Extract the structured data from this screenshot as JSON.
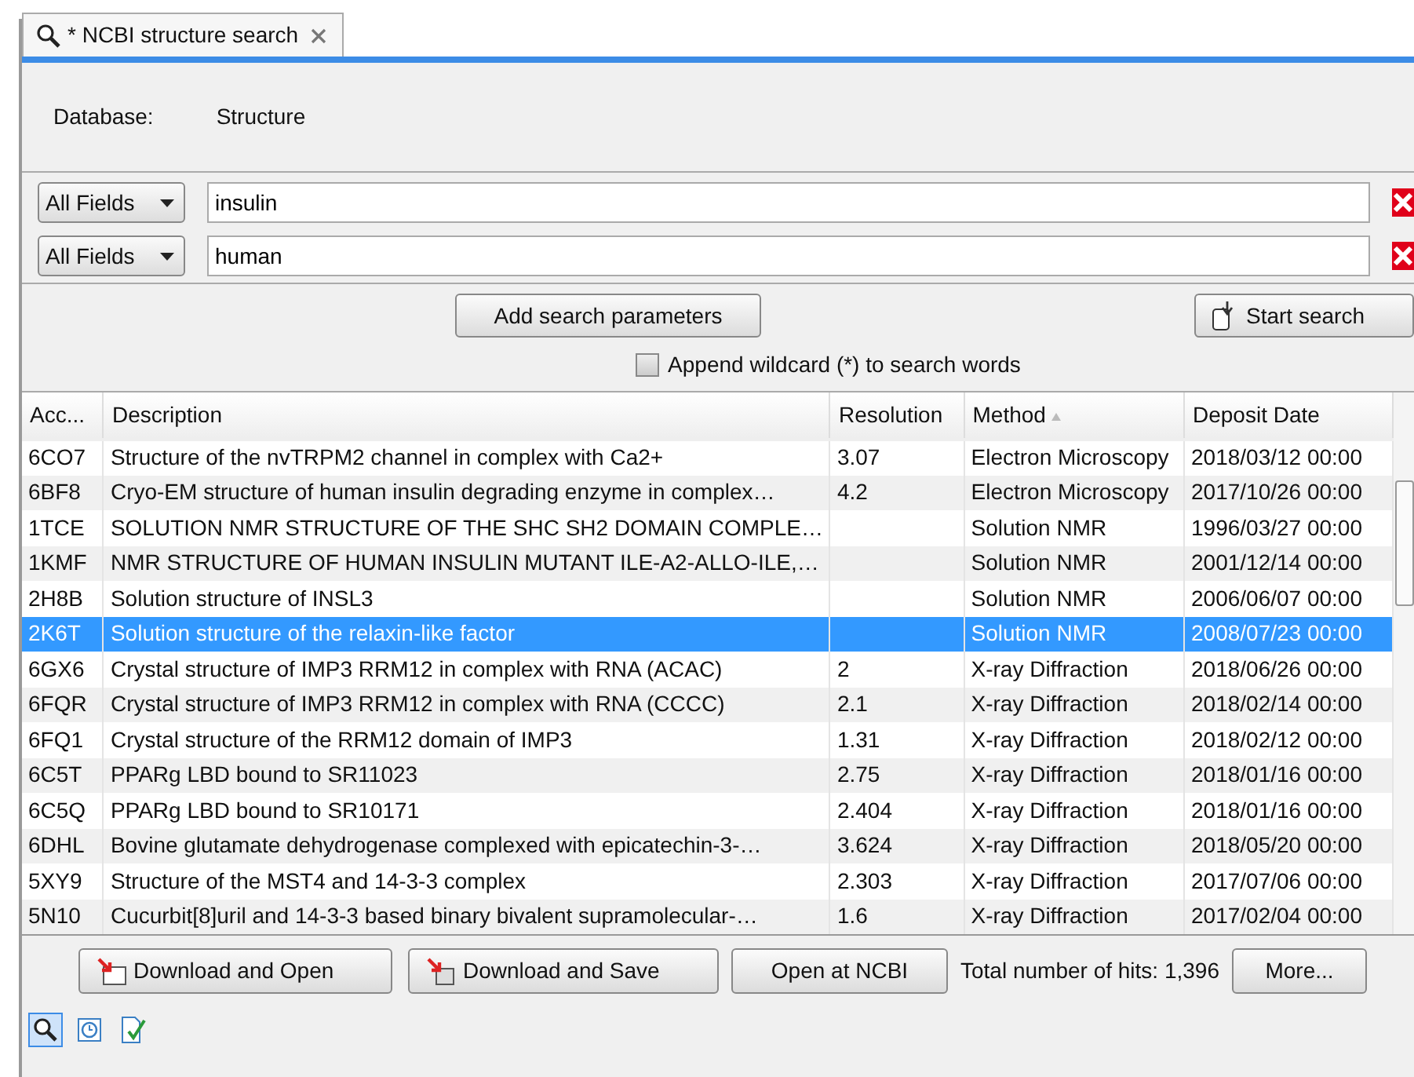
{
  "tab": {
    "title": "* NCBI structure search",
    "selected": true
  },
  "database": {
    "label": "Database:",
    "value": "Structure"
  },
  "search_rows": [
    {
      "field": "All Fields",
      "value": "insulin"
    },
    {
      "field": "All Fields",
      "value": "human"
    }
  ],
  "buttons": {
    "add": "Add search parameters",
    "start": "Start search"
  },
  "wildcard": {
    "label": "Append wildcard (*) to search words",
    "checked": false
  },
  "table": {
    "columns": [
      {
        "label": "Acc...",
        "sorted": false
      },
      {
        "label": "Description",
        "sorted": false
      },
      {
        "label": "Resolution",
        "sorted": false
      },
      {
        "label": "Method",
        "sorted": true
      },
      {
        "label": "Deposit Date",
        "sorted": false
      }
    ],
    "rows": [
      {
        "acc": "6CO7",
        "description": "Structure of the nvTRPM2 channel in complex with Ca2+",
        "resolution": "3.07",
        "method": "Electron Microscopy",
        "date": "2018/03/12 00:00",
        "selected": false
      },
      {
        "acc": "6BF8",
        "description": "Cryo-EM structure of human insulin degrading enzyme in complex…",
        "resolution": "4.2",
        "method": "Electron Microscopy",
        "date": "2017/10/26 00:00",
        "selected": false
      },
      {
        "acc": "1TCE",
        "description": "SOLUTION NMR STRUCTURE OF THE SHC SH2 DOMAIN COMPLE…",
        "method": "Solution NMR",
        "date": "1996/03/27 00:00",
        "selected": false
      },
      {
        "acc": "1KMF",
        "description": "NMR STRUCTURE OF HUMAN INSULIN MUTANT ILE-A2-ALLO-ILE,…",
        "method": "Solution NMR",
        "date": "2001/12/14 00:00",
        "selected": false
      },
      {
        "acc": "2H8B",
        "description": "Solution structure of INSL3",
        "method": "Solution NMR",
        "date": "2006/06/07 00:00",
        "selected": false
      },
      {
        "acc": "2K6T",
        "description": "Solution structure of the relaxin-like factor",
        "method": "Solution NMR",
        "date": "2008/07/23 00:00",
        "selected": true
      },
      {
        "acc": "6GX6",
        "description": "Crystal structure of IMP3 RRM12 in complex with RNA (ACAC)",
        "resolution": "2",
        "method": "X-ray Diffraction",
        "date": "2018/06/26 00:00",
        "selected": false
      },
      {
        "acc": "6FQR",
        "description": "Crystal structure of IMP3 RRM12 in complex with RNA (CCCC)",
        "resolution": "2.1",
        "method": "X-ray Diffraction",
        "date": "2018/02/14 00:00",
        "selected": false
      },
      {
        "acc": "6FQ1",
        "description": "Crystal structure of the RRM12 domain of IMP3",
        "resolution": "1.31",
        "method": "X-ray Diffraction",
        "date": "2018/02/12 00:00",
        "selected": false
      },
      {
        "acc": "6C5T",
        "description": "PPARg LBD bound to SR11023",
        "resolution": "2.75",
        "method": "X-ray Diffraction",
        "date": "2018/01/16 00:00",
        "selected": false
      },
      {
        "acc": "6C5Q",
        "description": "PPARg LBD bound to SR10171",
        "resolution": "2.404",
        "method": "X-ray Diffraction",
        "date": "2018/01/16 00:00",
        "selected": false
      },
      {
        "acc": "6DHL",
        "description": "Bovine glutamate dehydrogenase complexed with epicatechin-3-…",
        "resolution": "3.624",
        "method": "X-ray Diffraction",
        "date": "2018/05/20 00:00",
        "selected": false
      },
      {
        "acc": "5XY9",
        "description": "Structure of the MST4 and 14-3-3 complex",
        "resolution": "2.303",
        "method": "X-ray Diffraction",
        "date": "2017/07/06 00:00",
        "selected": false
      },
      {
        "acc": "5N10",
        "description": "Cucurbit[8]uril and 14-3-3 based binary bivalent supramolecular-…",
        "resolution": "1.6",
        "method": "X-ray Diffraction",
        "date": "2017/02/04 00:00",
        "selected": false
      }
    ]
  },
  "footer": {
    "download_open": "Download and Open",
    "download_save": "Download and Save",
    "open_ncbi": "Open at NCBI",
    "hits": "Total number of hits: 1,396",
    "more": "More..."
  },
  "view_tabs": [
    {
      "kind": "search",
      "selected": true
    },
    {
      "kind": "history",
      "selected": false
    },
    {
      "kind": "checklist",
      "selected": false
    }
  ]
}
